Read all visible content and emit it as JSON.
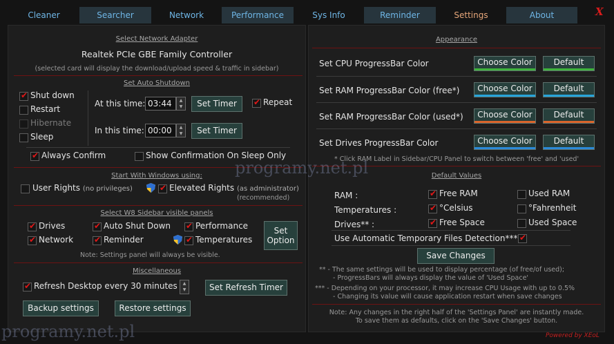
{
  "tabs": [
    {
      "label": "Cleaner"
    },
    {
      "label": "Searcher"
    },
    {
      "label": "Network"
    },
    {
      "label": "Performance"
    },
    {
      "label": "Sys Info"
    },
    {
      "label": "Reminder"
    },
    {
      "label": "Settings"
    },
    {
      "label": "About"
    }
  ],
  "close_label": "X",
  "network": {
    "heading": "Select Network Adapter",
    "adapter": "Realtek PCIe GBE Family Controller",
    "note": "(selected card will display the download/upload speed & traffic in sidebar)"
  },
  "shutdown": {
    "heading": "Set Auto Shutdown",
    "options": [
      "Shut down",
      "Restart",
      "Hibernate",
      "Sleep"
    ],
    "at_label": "At this time:",
    "at_value": "03:44",
    "in_label": "In this time:",
    "in_value": "00:00",
    "set_timer": "Set Timer",
    "repeat": "Repeat",
    "always_confirm": "Always Confirm",
    "show_confirm_sleep": "Show Confirmation On Sleep Only"
  },
  "startup": {
    "heading": "Start With Windows using:",
    "user_rights": "User Rights",
    "user_rights_note": "(no privileges)",
    "elevated_rights": "Elevated Rights",
    "elevated_note1": "(as administrator)",
    "elevated_note2": "(recommended)"
  },
  "sidebar": {
    "heading": "Select W8 Sidebar visible panels",
    "items": [
      "Drives",
      "Auto Shut Down",
      "Performance",
      "Network",
      "Reminder",
      "Temperatures"
    ],
    "set_option_line1": "Set",
    "set_option_line2": "Option",
    "note": "Note:   Settings panel will always be visible."
  },
  "misc": {
    "heading": "Miscellaneous",
    "refresh_label": "Refresh Desktop every 30 minutes",
    "set_refresh_timer": "Set Refresh Timer",
    "backup": "Backup settings",
    "restore": "Restore settings"
  },
  "appearance": {
    "heading": "Appearance",
    "rows": [
      {
        "label": "Set CPU ProgressBar Color",
        "color": "#3fb33c"
      },
      {
        "label": "Set RAM ProgressBar Color (free*)",
        "color": "#27a3d9"
      },
      {
        "label": "Set RAM ProgressBar Color (used*)",
        "color": "#d9642b"
      },
      {
        "label": "Set Drives ProgressBar Color",
        "color": "#2b8ad9"
      }
    ],
    "choose_color": "Choose Color",
    "default": "Default",
    "note": "* Click RAM Label in Sidebar/CPU Panel to switch between 'free' and 'used'"
  },
  "defaults": {
    "heading": "Default Values",
    "ram_label": "RAM :",
    "free_ram": "Free RAM",
    "used_ram": "Used RAM",
    "temp_label": "Temperatures :",
    "celsius": "°Celsius",
    "fahrenheit": "°Fahrenheit",
    "drives_label": "Drives** :",
    "free_space": "Free Space",
    "used_space": "Used Space",
    "auto_temp": "Use Automatic Temporary Files Detection***",
    "save": "Save Changes",
    "note1a": "** - The same settings will be used to display percentage (of free/of used);",
    "note1b": "- ProgressBars will always display the value of 'Used Space'",
    "note2a": "*** - Depending on your processor, it may increase CPU Usage with up to 0.5%",
    "note2b": "- Changing its value will cause application restart when save changes",
    "note3a": "Note: Any changes in the right half of the 'Settings Panel' are instantly made.",
    "note3b": "To save them as defaults, click on the 'Save Changes' button."
  },
  "footer": "Powered by XEoL",
  "watermark1": "programy.net.pl",
  "watermark2": "programy.net.pl"
}
